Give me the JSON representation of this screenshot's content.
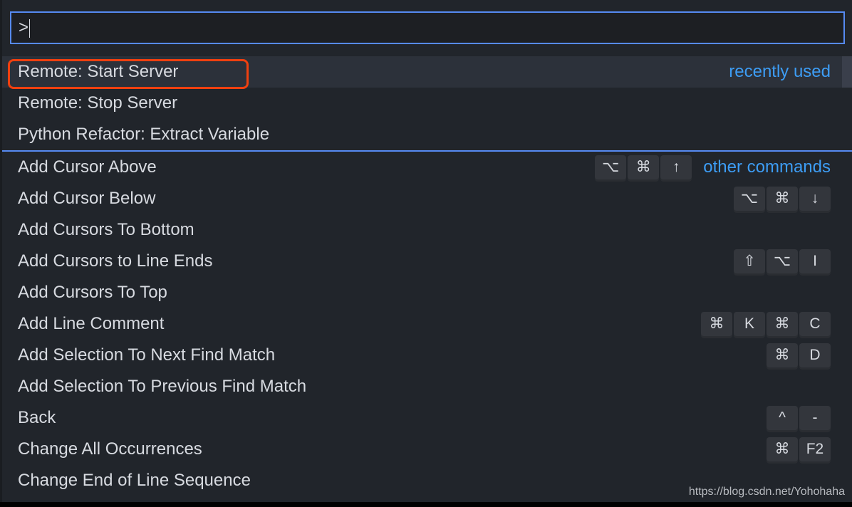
{
  "input": {
    "value": ">"
  },
  "items": [
    {
      "label": "Remote: Start Server",
      "keys": [],
      "group": "recently used",
      "selected": true
    },
    {
      "label": "Remote: Stop Server",
      "keys": []
    },
    {
      "label": "Python Refactor: Extract Variable",
      "keys": []
    },
    {
      "label": "Add Cursor Above",
      "keys": [
        "⌥",
        "⌘",
        "↑"
      ],
      "group": "other commands",
      "separator": true
    },
    {
      "label": "Add Cursor Below",
      "keys": [
        "⌥",
        "⌘",
        "↓"
      ]
    },
    {
      "label": "Add Cursors To Bottom",
      "keys": []
    },
    {
      "label": "Add Cursors to Line Ends",
      "keys": [
        "⇧",
        "⌥",
        "I"
      ]
    },
    {
      "label": "Add Cursors To Top",
      "keys": []
    },
    {
      "label": "Add Line Comment",
      "keys": [
        "⌘",
        "K",
        "⌘",
        "C"
      ]
    },
    {
      "label": "Add Selection To Next Find Match",
      "keys": [
        "⌘",
        "D"
      ]
    },
    {
      "label": "Add Selection To Previous Find Match",
      "keys": []
    },
    {
      "label": "Back",
      "keys": [
        "^",
        "-"
      ]
    },
    {
      "label": "Change All Occurrences",
      "keys": [
        "⌘",
        "F2"
      ]
    },
    {
      "label": "Change End of Line Sequence",
      "keys": []
    }
  ],
  "watermark": "https://blog.csdn.net/Yohohaha",
  "colors": {
    "accent": "#568af2",
    "group_label": "#3d9df5",
    "highlight_box": "#f0400f",
    "background": "#21252b"
  }
}
